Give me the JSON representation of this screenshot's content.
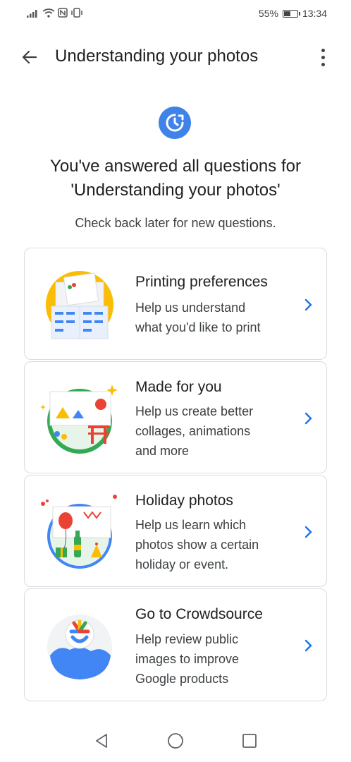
{
  "status_bar": {
    "battery_percent": "55%",
    "battery_level": 0.55,
    "time": "13:34"
  },
  "app_bar": {
    "title": "Understanding your photos",
    "back_icon": "arrow-back-icon",
    "menu_icon": "more-vert-icon"
  },
  "hero": {
    "icon": "clock-check-icon",
    "headline_line1": "You've answered all questions for",
    "headline_line2": "'Understanding your photos'",
    "subtext": "Check back later for new questions."
  },
  "cards": [
    {
      "title": "Printing preferences",
      "desc_line1": "Help us understand",
      "desc_line2": "what you'd like to print",
      "desc_line3": ""
    },
    {
      "title": "Made for you",
      "desc_line1": "Help us create better",
      "desc_line2": "collages, animations",
      "desc_line3": "and more"
    },
    {
      "title": "Holiday photos",
      "desc_line1": "Help us learn which",
      "desc_line2": "photos show a certain",
      "desc_line3": "holiday or event."
    },
    {
      "title": "Go to Crowdsource",
      "desc_line1": "Help review public",
      "desc_line2": "images to improve",
      "desc_line3": "Google products"
    }
  ],
  "colors": {
    "accent_blue": "#4285f4",
    "chevron_blue": "#1a73e8",
    "yellow": "#fbbc04",
    "green": "#34a853",
    "red": "#ea4335"
  },
  "nav": {
    "back": "nav-back-icon",
    "home": "nav-home-icon",
    "recents": "nav-recents-icon"
  }
}
